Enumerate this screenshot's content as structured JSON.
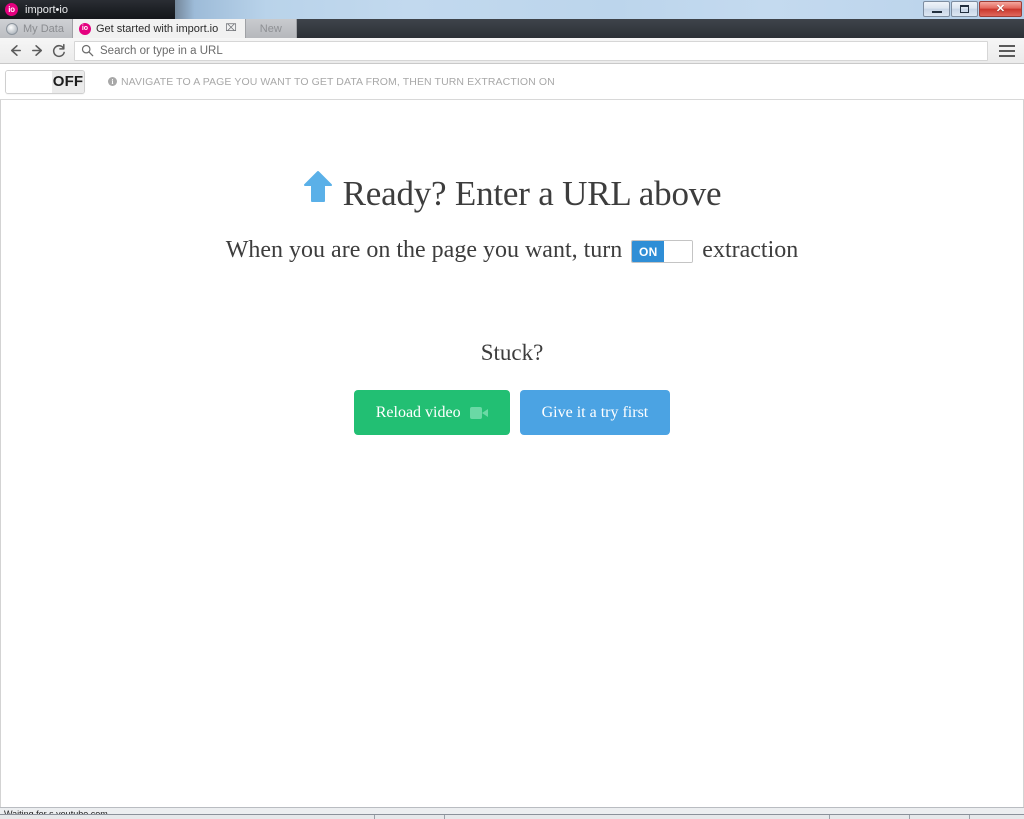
{
  "window": {
    "app_title": "import•io",
    "logo_text": "io",
    "controls": {
      "minimize": "minimize-button",
      "maximize": "maximize-button",
      "close": "✕"
    }
  },
  "tabs": [
    {
      "label": "My Data",
      "favicon": "globe-icon",
      "active": false,
      "has_close": false
    },
    {
      "label": "Get started with import.io",
      "favicon": "importio-icon",
      "favicon_text": "io",
      "active": true,
      "has_close": true,
      "close_glyph": "⌧"
    },
    {
      "label": "New",
      "favicon": "",
      "active": false,
      "has_close": false
    }
  ],
  "navbar": {
    "back_label": "←",
    "forward_label": "→",
    "reload_label": "⟳",
    "search_icon": "search-icon",
    "url_placeholder": "Search or type in a URL",
    "url_value": "",
    "menu_label": "hamburger-menu-icon"
  },
  "extraction_bar": {
    "toggle_state": "OFF",
    "hint_icon": "i",
    "hint_text": "NAVIGATE TO A PAGE YOU WANT TO GET DATA FROM, THEN TURN EXTRACTION ON"
  },
  "content": {
    "arrow_icon": "arrow-up-icon",
    "title": "Ready? Enter a URL above",
    "subtitle_before": "When you are on the page you want, turn",
    "inline_toggle_on": "ON",
    "subtitle_after": "extraction",
    "stuck_label": "Stuck?",
    "buttons": [
      {
        "label": "Reload video",
        "icon": "video-camera-icon",
        "color": "#22bf73"
      },
      {
        "label": "Give it a try first",
        "icon": "",
        "color": "#4ba3e3"
      }
    ]
  },
  "statusbar": {
    "text": "Waiting for s.youtube.com..."
  },
  "colors": {
    "accent_blue": "#4ba3e3",
    "toggle_on_blue": "#2f8ed6",
    "green": "#22bf73",
    "brand_pink": "#e4007f",
    "arrow_blue": "#5ab0e8"
  }
}
